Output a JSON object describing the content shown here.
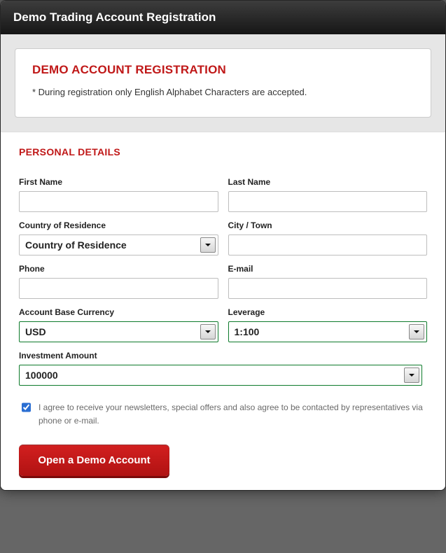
{
  "titlebar": "Demo Trading Account Registration",
  "notice": {
    "heading": "DEMO ACCOUNT REGISTRATION",
    "text": "* During registration only English Alphabet Characters are accepted."
  },
  "sections": {
    "personal": "PERSONAL DETAILS"
  },
  "labels": {
    "first_name": "First Name",
    "last_name": "Last Name",
    "country": "Country of Residence",
    "city": "City / Town",
    "phone": "Phone",
    "email": "E-mail",
    "currency": "Account Base Currency",
    "leverage": "Leverage",
    "investment": "Investment Amount"
  },
  "values": {
    "first_name": "",
    "last_name": "",
    "country_selected": "Country of Residence",
    "city": "",
    "phone": "",
    "email": "",
    "currency_selected": "USD",
    "leverage_selected": "1:100",
    "investment_selected": "100000"
  },
  "consent": {
    "checked": true,
    "text": "I agree to receive your newsletters, special offers and also agree to be contacted by representatives via phone or e-mail."
  },
  "buttons": {
    "submit": "Open a Demo Account"
  }
}
